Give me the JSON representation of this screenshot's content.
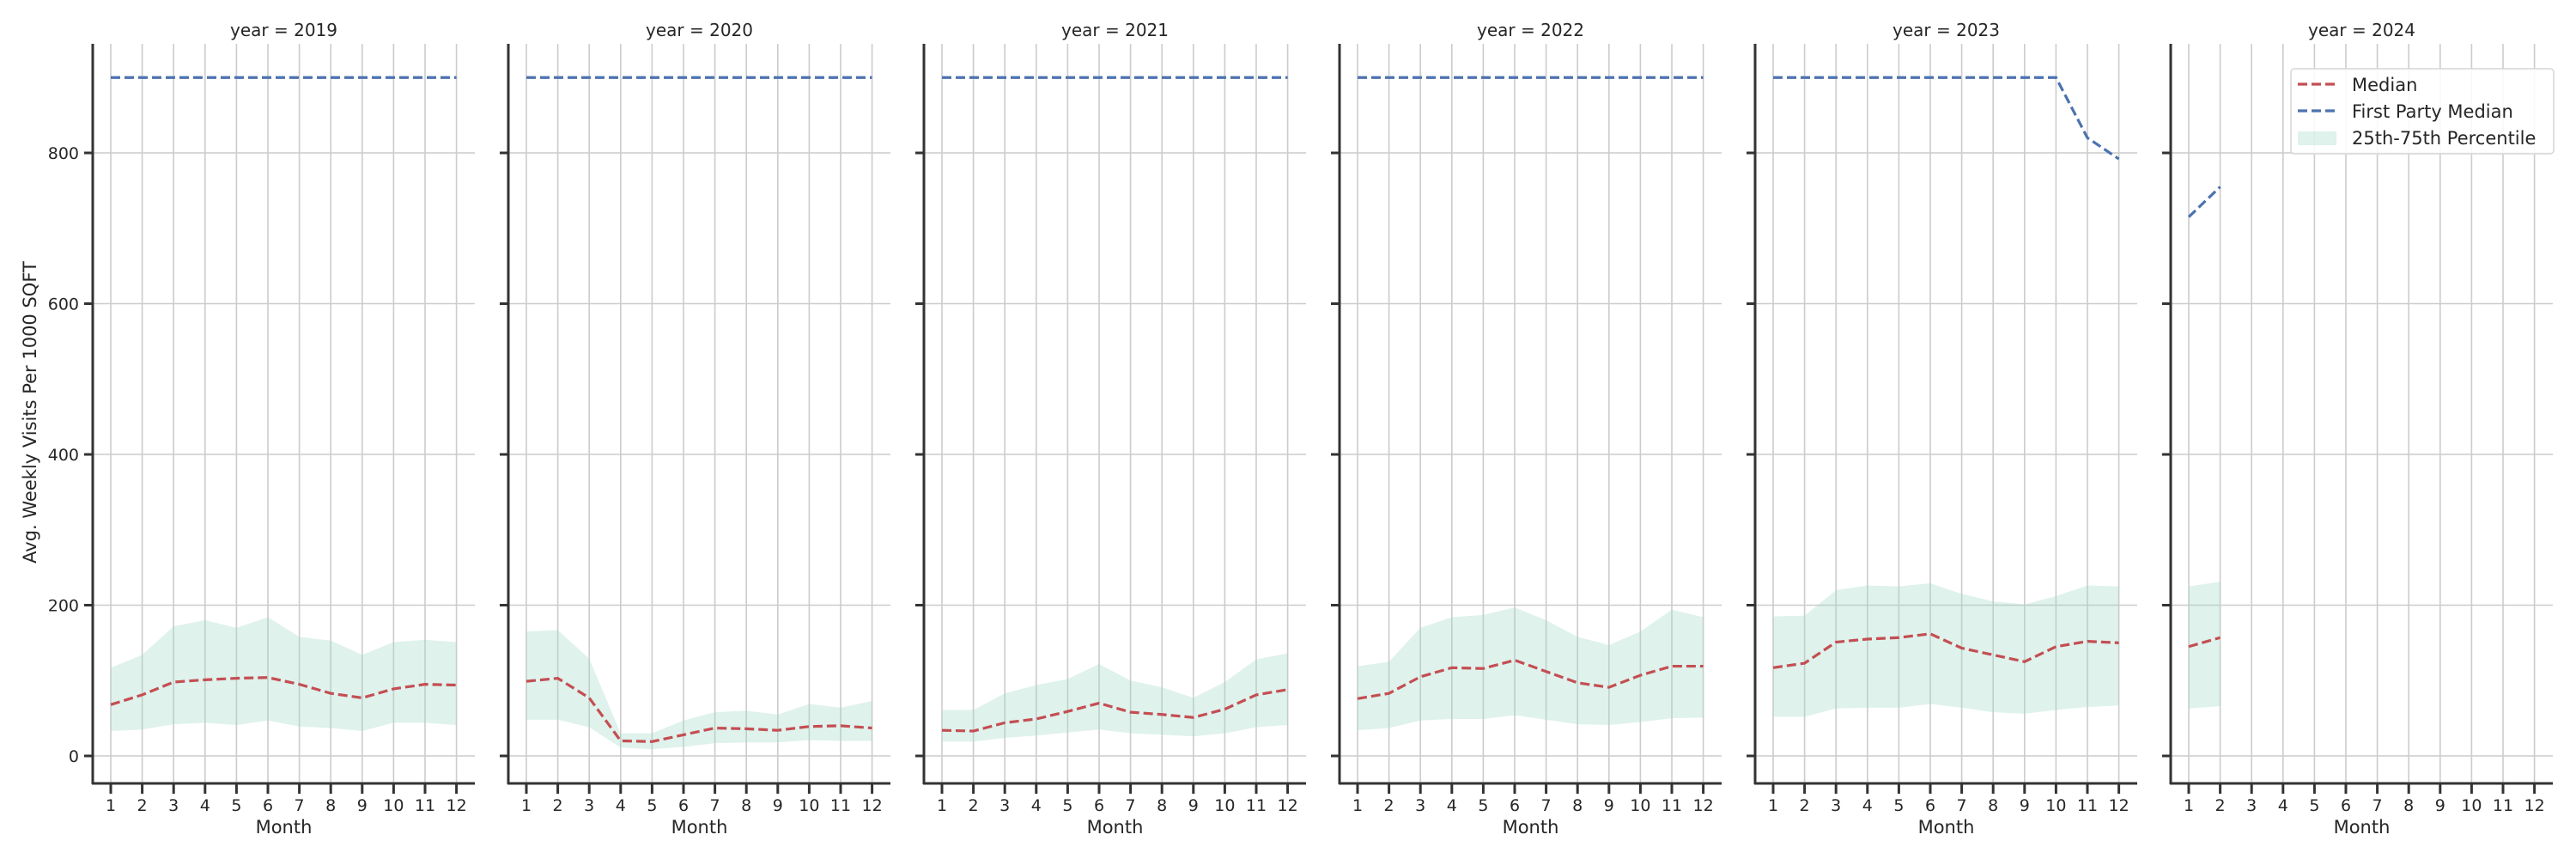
{
  "chart_data": {
    "type": "line",
    "layout": "facet-grid",
    "facet_variable": "year",
    "xlabel": "Month",
    "ylabel": "Avg. Weekly Visits Per 1000 SQFT",
    "x_ticks": [
      1,
      2,
      3,
      4,
      5,
      6,
      7,
      8,
      9,
      10,
      11,
      12
    ],
    "y_ticks": [
      0,
      200,
      400,
      600,
      800
    ],
    "ylim": [
      -85,
      960
    ],
    "xlim": [
      0.45,
      12.55
    ],
    "grid": true,
    "legend": {
      "placement": "upper-right of last panel",
      "entries": [
        {
          "label": "Median",
          "type": "dashed-line",
          "color": "#c44e52"
        },
        {
          "label": "First Party Median",
          "type": "dashed-line",
          "color": "#4c72b0"
        },
        {
          "label": "25th-75th Percentile",
          "type": "band",
          "color": "#dff1ec"
        }
      ]
    },
    "panels": [
      {
        "title": "year = 2019",
        "months": [
          1,
          2,
          3,
          4,
          5,
          6,
          7,
          8,
          9,
          10,
          11,
          12
        ],
        "median": [
          68,
          81,
          98,
          101,
          103,
          104,
          95,
          83,
          77,
          89,
          95,
          94
        ],
        "first_party_median": [
          900,
          900,
          900,
          900,
          900,
          900,
          900,
          900,
          900,
          900,
          900,
          900
        ],
        "p25": [
          33,
          35,
          42,
          44,
          41,
          47,
          39,
          37,
          33,
          44,
          44,
          41
        ],
        "p75": [
          117,
          134,
          172,
          180,
          170,
          184,
          158,
          153,
          134,
          151,
          154,
          151
        ]
      },
      {
        "title": "year = 2020",
        "months": [
          1,
          2,
          3,
          4,
          5,
          6,
          7,
          8,
          9,
          10,
          11,
          12
        ],
        "median": [
          99,
          103,
          77,
          20,
          19,
          28,
          37,
          36,
          34,
          39,
          40,
          37
        ],
        "first_party_median": [
          900,
          900,
          900,
          900,
          900,
          900,
          900,
          900,
          900,
          900,
          900,
          900
        ],
        "p25": [
          48,
          48,
          38,
          11,
          9,
          12,
          17,
          18,
          18,
          21,
          20,
          20
        ],
        "p75": [
          165,
          167,
          129,
          30,
          30,
          47,
          58,
          60,
          55,
          69,
          64,
          73
        ]
      },
      {
        "title": "year = 2021",
        "months": [
          1,
          2,
          3,
          4,
          5,
          6,
          7,
          8,
          9,
          10,
          11,
          12
        ],
        "median": [
          34,
          33,
          44,
          49,
          59,
          70,
          58,
          55,
          51,
          62,
          81,
          88
        ],
        "first_party_median": [
          900,
          900,
          900,
          900,
          900,
          900,
          900,
          900,
          900,
          900,
          900,
          900
        ],
        "p25": [
          19,
          19,
          24,
          27,
          31,
          35,
          30,
          28,
          26,
          30,
          38,
          41
        ],
        "p75": [
          61,
          61,
          83,
          94,
          102,
          122,
          100,
          91,
          77,
          98,
          128,
          136
        ]
      },
      {
        "title": "year = 2022",
        "months": [
          1,
          2,
          3,
          4,
          5,
          6,
          7,
          8,
          9,
          10,
          11,
          12
        ],
        "median": [
          76,
          83,
          105,
          117,
          116,
          127,
          112,
          97,
          91,
          107,
          119,
          119
        ],
        "first_party_median": [
          900,
          900,
          900,
          900,
          900,
          900,
          900,
          900,
          900,
          900,
          900,
          900
        ],
        "p25": [
          34,
          37,
          47,
          49,
          49,
          54,
          48,
          42,
          41,
          45,
          50,
          51
        ],
        "p75": [
          119,
          125,
          170,
          184,
          187,
          197,
          180,
          158,
          147,
          165,
          194,
          184
        ]
      },
      {
        "title": "year = 2023",
        "months": [
          1,
          2,
          3,
          4,
          5,
          6,
          7,
          8,
          9,
          10,
          11,
          12
        ],
        "median": [
          117,
          123,
          151,
          155,
          157,
          162,
          143,
          134,
          125,
          145,
          152,
          150
        ],
        "first_party_median": [
          900,
          900,
          900,
          900,
          900,
          900,
          900,
          900,
          900,
          900,
          820,
          792
        ],
        "p25": [
          52,
          52,
          63,
          64,
          64,
          69,
          64,
          58,
          56,
          61,
          65,
          67
        ],
        "p75": [
          185,
          186,
          220,
          226,
          225,
          229,
          215,
          205,
          201,
          212,
          226,
          225
        ]
      },
      {
        "title": "year = 2024",
        "months": [
          1,
          2
        ],
        "median": [
          145,
          157
        ],
        "first_party_median": [
          715,
          755
        ],
        "p25": [
          63,
          66
        ],
        "p75": [
          225,
          231
        ]
      }
    ]
  }
}
